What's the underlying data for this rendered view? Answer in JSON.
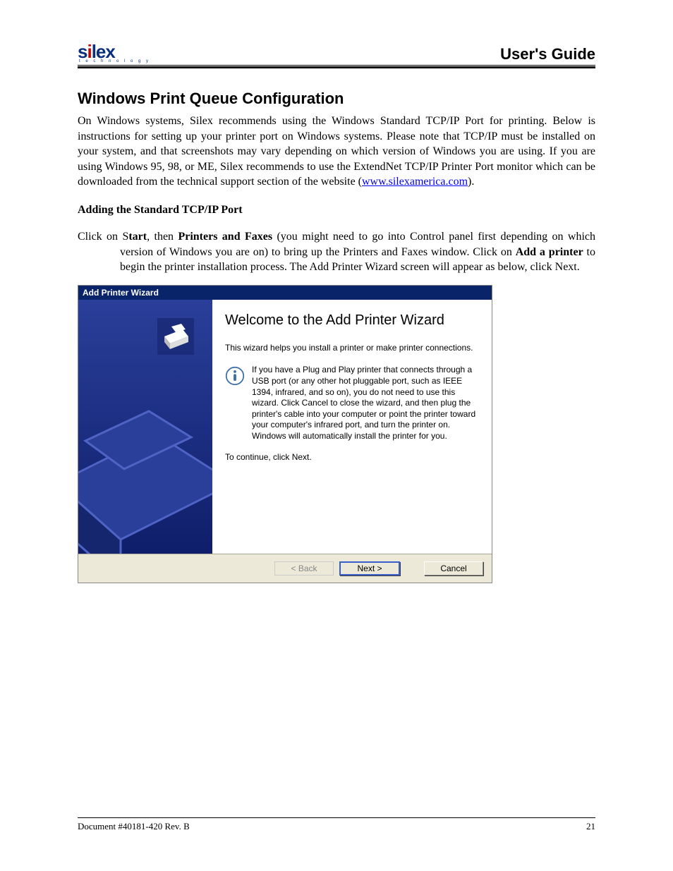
{
  "header": {
    "logo_main": "silex",
    "logo_sub": "t e c h n o l o g y",
    "guide_title": "User's Guide"
  },
  "section": {
    "title": "Windows Print Queue Configuration",
    "intro_prefix": "On Windows systems, Silex recommends using the Windows Standard TCP/IP Port for printing. Below is instructions for setting up your printer port on Windows systems. Please note that TCP/IP must be installed on your system, and that screenshots may vary depending on which version of Windows you are using. If you are using Windows 95, 98, or ME, Silex recommends to use the ExtendNet TCP/IP Printer Port monitor which can be downloaded from the technical support section of the website (",
    "intro_link": "www.silexamerica.com",
    "intro_suffix": ").",
    "sub_heading": "Adding the Standard TCP/IP Port",
    "step_a": "Click on S",
    "step_b": "tart",
    "step_c": ", then ",
    "step_d": "Printers and Faxes",
    "step_e": " (you might need to go into Control panel first depending on which version of Windows you are on) to bring up the Printers and Faxes window. Click on ",
    "step_f": "Add a printer",
    "step_g": " to begin the printer installation process. The Add Printer Wizard screen will appear as below, click Next."
  },
  "wizard": {
    "titlebar": "Add Printer Wizard",
    "heading": "Welcome to the Add Printer Wizard",
    "intro": "This wizard helps you install a printer or make printer connections.",
    "info": "If you have a Plug and Play printer that connects through a USB port (or any other hot pluggable port, such as IEEE 1394, infrared, and so on), you do not need to use this wizard. Click Cancel to close the wizard, and then plug the printer's cable into your computer or point the printer toward your computer's infrared port, and turn the printer on. Windows will automatically install the printer for you.",
    "continue": "To continue, click Next.",
    "buttons": {
      "back": "< Back",
      "next": "Next >",
      "cancel": "Cancel"
    }
  },
  "footer": {
    "doc": "Document #40181-420  Rev. B",
    "page": "21"
  }
}
